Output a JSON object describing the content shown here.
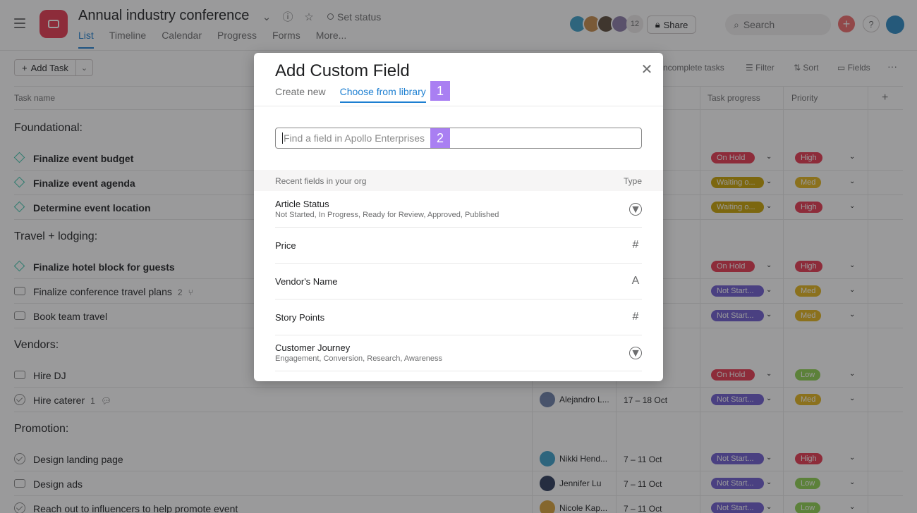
{
  "header": {
    "title": "Annual industry conference",
    "set_status": "Set status",
    "tabs": [
      "List",
      "Timeline",
      "Calendar",
      "Progress",
      "Forms",
      "More..."
    ],
    "member_count": "12",
    "share_label": "Share",
    "search_placeholder": "Search",
    "help_label": "?"
  },
  "toolbar": {
    "add_task_label": "Add Task",
    "incomplete_label": "ncomplete tasks",
    "filter_label": "Filter",
    "sort_label": "Sort",
    "fields_label": "Fields"
  },
  "table": {
    "col_task_name": "Task name",
    "col_task_progress": "Task progress",
    "col_priority": "Priority"
  },
  "sections": {
    "foundational": "Foundational:",
    "travel": "Travel + lodging:",
    "vendors": "Vendors:",
    "promotion": "Promotion:"
  },
  "tasks": [
    {
      "name": "Finalize event budget",
      "progress": "On Hold",
      "priority": "High"
    },
    {
      "name": "Finalize event agenda",
      "progress": "Waiting o...",
      "priority": "Med"
    },
    {
      "name": "Determine event location",
      "progress": "Waiting o...",
      "priority": "High"
    },
    {
      "name": "Finalize hotel block for guests",
      "progress": "On Hold",
      "priority": "High"
    },
    {
      "name": "Finalize conference travel plans",
      "meta": "2",
      "progress": "Not Start...",
      "priority": "Med"
    },
    {
      "name": "Book team travel",
      "progress": "Not Start...",
      "priority": "Med"
    },
    {
      "name": "Hire DJ",
      "progress": "On Hold",
      "priority": "Low"
    },
    {
      "name": "Hire caterer",
      "meta": "1",
      "assignee": "Alejandro L...",
      "date": "17 – 18 Oct",
      "progress": "Not Start...",
      "priority": "Med"
    },
    {
      "name": "Design landing page",
      "assignee": "Nikki Hend...",
      "date": "7 – 11 Oct",
      "progress": "Not Start...",
      "priority": "High"
    },
    {
      "name": "Design ads",
      "assignee": "Jennifer Lu",
      "date": "7 – 11 Oct",
      "progress": "Not Start...",
      "priority": "Low"
    },
    {
      "name": "Reach out to influencers to help promote event",
      "assignee": "Nicole Kap...",
      "date": "7 – 11 Oct",
      "progress": "Not Start...",
      "priority": "Low"
    }
  ],
  "dialog": {
    "title": "Add Custom Field",
    "tab_create": "Create new",
    "tab_library": "Choose from library",
    "badge_1": "1",
    "badge_2": "2",
    "search_placeholder": "Find a field in Apollo Enterprises",
    "recent_label": "Recent fields in your org",
    "type_label": "Type",
    "fields": [
      {
        "name": "Article Status",
        "options": "Not Started, In Progress, Ready for Review, Approved, Published",
        "type": "dropdown-icon"
      },
      {
        "name": "Price",
        "type": "number-icon"
      },
      {
        "name": "Vendor's Name",
        "type": "text-icon"
      },
      {
        "name": "Story Points",
        "type": "number-icon"
      },
      {
        "name": "Customer Journey",
        "options": "Engagement, Conversion, Research, Awareness",
        "type": "dropdown-icon"
      }
    ]
  },
  "colors": {
    "on_hold": "#e8384f",
    "waiting": "#c9a300",
    "not_started": "#6d5bd0",
    "high": "#e8384f",
    "med": "#e3b51b",
    "low": "#8fd14f",
    "accent": "#1d7fd1",
    "badge": "#a97ff2"
  }
}
